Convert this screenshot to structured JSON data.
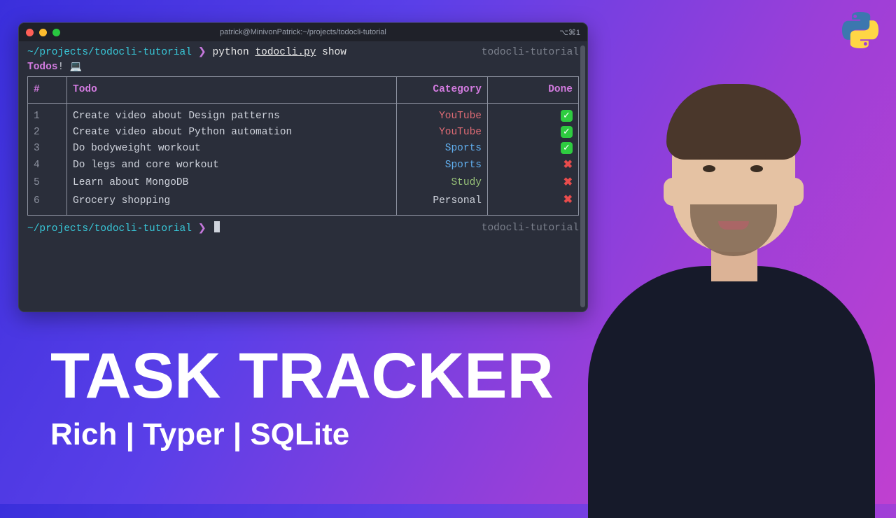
{
  "titlebar": {
    "title": "patrick@MinivonPatrick:~/projects/todocli-tutorial",
    "right": "⌥⌘1"
  },
  "prompt": {
    "path": "~/projects/todocli-tutorial",
    "sep": "❯",
    "command_prefix": "python ",
    "command_file": "todocli.py",
    "command_suffix": " show",
    "env": "todocli-tutorial"
  },
  "output": {
    "header_label": "Todos",
    "header_bang": "!",
    "header_emoji": "💻"
  },
  "table": {
    "headers": {
      "num": "#",
      "todo": "Todo",
      "category": "Category",
      "done": "Done"
    },
    "rows": [
      {
        "n": "1",
        "todo": "Create video about Design patterns",
        "category": "YouTube",
        "cat_class": "cat-youtube",
        "done": true
      },
      {
        "n": "2",
        "todo": "Create video about Python automation",
        "category": "YouTube",
        "cat_class": "cat-youtube",
        "done": true
      },
      {
        "n": "3",
        "todo": "Do bodyweight workout",
        "category": "Sports",
        "cat_class": "cat-sports",
        "done": true
      },
      {
        "n": "4",
        "todo": "Do legs and core workout",
        "category": "Sports",
        "cat_class": "cat-sports",
        "done": false
      },
      {
        "n": "5",
        "todo": "Learn about MongoDB",
        "category": "Study",
        "cat_class": "cat-study",
        "done": false
      },
      {
        "n": "6",
        "todo": "Grocery shopping",
        "category": "Personal",
        "cat_class": "cat-personal",
        "done": false
      }
    ]
  },
  "prompt2": {
    "path": "~/projects/todocli-tutorial",
    "sep": "❯",
    "env": "todocli-tutorial"
  },
  "headline": {
    "title": "TASK TRACKER",
    "subtitle": "Rich | Typer | SQLite"
  },
  "icons": {
    "done_yes": "✓",
    "done_no": "✖"
  }
}
